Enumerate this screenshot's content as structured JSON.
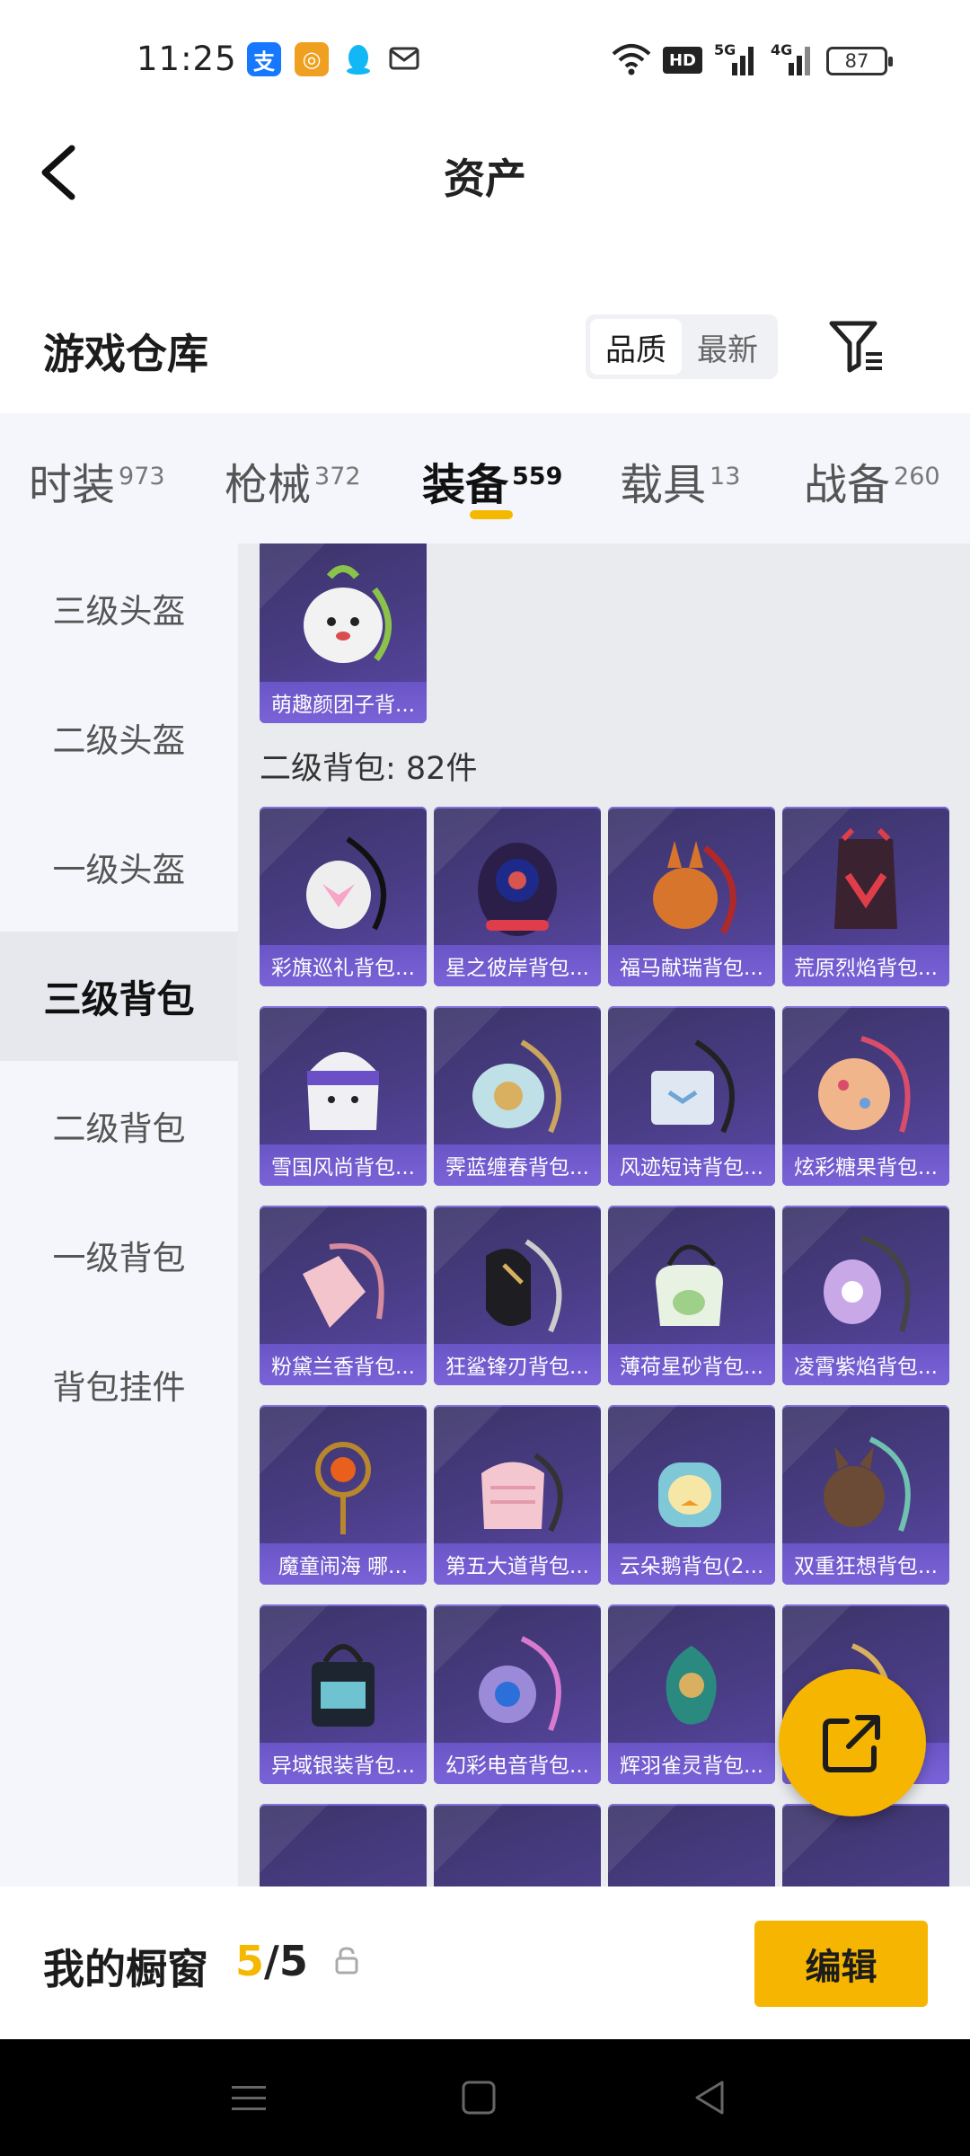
{
  "status_bar": {
    "time": "11:25",
    "battery": "87",
    "network_labels": [
      "HD",
      "5G",
      "4G"
    ]
  },
  "header": {
    "title": "资产"
  },
  "warehouse": {
    "title": "游戏仓库",
    "sort_options": [
      "品质",
      "最新"
    ],
    "active_sort": "品质"
  },
  "tabs": [
    {
      "label": "时装",
      "count": "973"
    },
    {
      "label": "枪械",
      "count": "372"
    },
    {
      "label": "装备",
      "count": "559"
    },
    {
      "label": "载具",
      "count": "13"
    },
    {
      "label": "战备",
      "count": "260"
    }
  ],
  "active_tab": "装备",
  "sidebar": {
    "items": [
      "三级头盔",
      "二级头盔",
      "一级头盔",
      "三级背包",
      "二级背包",
      "一级背包",
      "背包挂件"
    ],
    "active": "三级背包"
  },
  "content": {
    "top_item": "萌趣颜团子背...",
    "section_title": "二级背包: 82件",
    "items": [
      "彩旗巡礼背包...",
      "星之彼岸背包...",
      "福马献瑞背包...",
      "荒原烈焰背包...",
      "雪国风尚背包...",
      "霁蓝缠春背包...",
      "风迹短诗背包...",
      "炫彩糖果背包...",
      "粉黛兰香背包...",
      "狂鲨锋刃背包...",
      "薄荷星砂背包...",
      "凌霄紫焰背包...",
      "魔童闹海 哪...",
      "第五大道背包...",
      "云朵鹅背包(2...",
      "双重狂想背包...",
      "异域银装背包...",
      "幻彩电音背包...",
      "辉羽雀灵背包...",
      ""
    ]
  },
  "showcase": {
    "title": "我的橱窗",
    "current": "5",
    "separator": "/",
    "total": "5",
    "edit_label": "编辑"
  },
  "colors": {
    "accent": "#f6b500",
    "card_bg": "#4a3d86",
    "card_label_bg": "#7a63d8"
  }
}
